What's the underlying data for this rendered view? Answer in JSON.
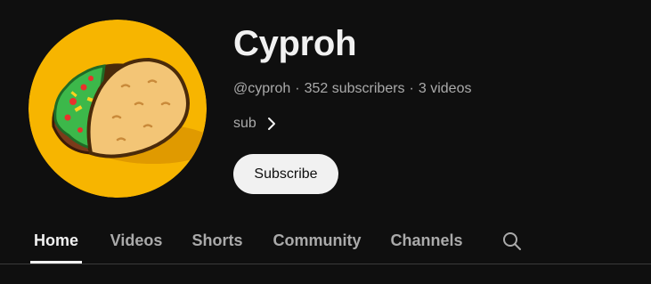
{
  "channel": {
    "name": "Cyproh",
    "handle": "@cyproh",
    "subscribers": "352 subscribers",
    "videos": "3 videos",
    "separator": "·",
    "about": "sub",
    "avatar_icon": "taco-icon"
  },
  "actions": {
    "subscribe_label": "Subscribe"
  },
  "tabs": [
    {
      "label": "Home",
      "active": true
    },
    {
      "label": "Videos",
      "active": false
    },
    {
      "label": "Shorts",
      "active": false
    },
    {
      "label": "Community",
      "active": false
    },
    {
      "label": "Channels",
      "active": false
    }
  ],
  "colors": {
    "background": "#0f0f0f",
    "avatar_bg": "#f7b500",
    "text_primary": "#f1f1f1",
    "text_secondary": "#aaaaaa",
    "button_bg": "#f1f1f1"
  }
}
